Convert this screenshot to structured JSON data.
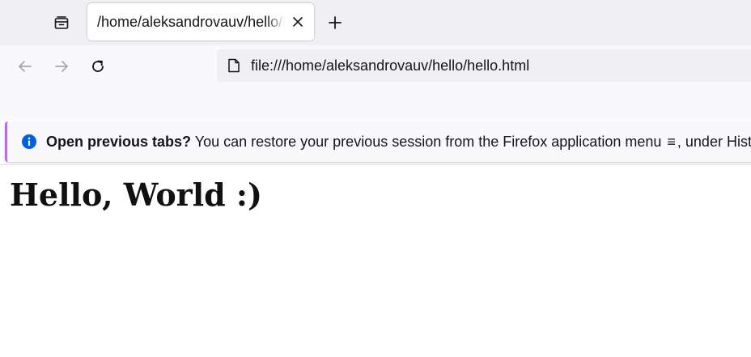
{
  "tabstrip": {
    "list_all_tabs_icon": "tab-list-icon",
    "active_tab": {
      "title": "/home/aleksandrovauv/hello/hello.html",
      "close_icon": "close-icon"
    },
    "new_tab_icon": "plus-icon"
  },
  "navbar": {
    "back_icon": "arrow-left-icon",
    "forward_icon": "arrow-right-icon",
    "reload_icon": "reload-icon",
    "url": "file:///home/aleksandrovauv/hello/hello.html",
    "page_icon": "page-icon"
  },
  "notification": {
    "icon": "info-icon",
    "title": "Open previous tabs?",
    "message": "You can restore your previous session from the Firefox application menu",
    "menu_glyph": "≡",
    "message_tail": ", under History.",
    "accent_color": "#b26fe6",
    "icon_color": "#0060df"
  },
  "page": {
    "heading": "Hello, World :)"
  }
}
